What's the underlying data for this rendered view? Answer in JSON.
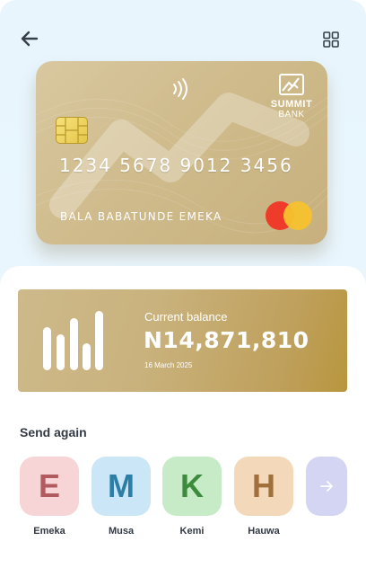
{
  "header": {
    "back_icon": "arrow-left-icon",
    "menu_icon": "grid-icon"
  },
  "card": {
    "bank_name": "SUMMIT",
    "bank_sub": "BANK",
    "number": "1234 5678 9012 3456",
    "holder": "BALA BABATUNDE EMEKA",
    "network_icon": "mastercard-icon",
    "colors": {
      "card": "#cfbb8c"
    }
  },
  "balance": {
    "label": "Current balance",
    "amount": "N14,871,810",
    "date": "16 March 2025"
  },
  "send_again": {
    "title": "Send again",
    "contacts": [
      {
        "initial": "E",
        "name": "Emeka",
        "bg": "#f7d4d5",
        "fg": "#b15a5f"
      },
      {
        "initial": "M",
        "name": "Musa",
        "bg": "#cbe7f7",
        "fg": "#2d7ea6"
      },
      {
        "initial": "K",
        "name": "Kemi",
        "bg": "#c6ebc6",
        "fg": "#3d8b3d"
      },
      {
        "initial": "H",
        "name": "Hauwa",
        "bg": "#f3d9b9",
        "fg": "#a06f3b"
      }
    ],
    "more_icon": "arrow-right-icon"
  }
}
